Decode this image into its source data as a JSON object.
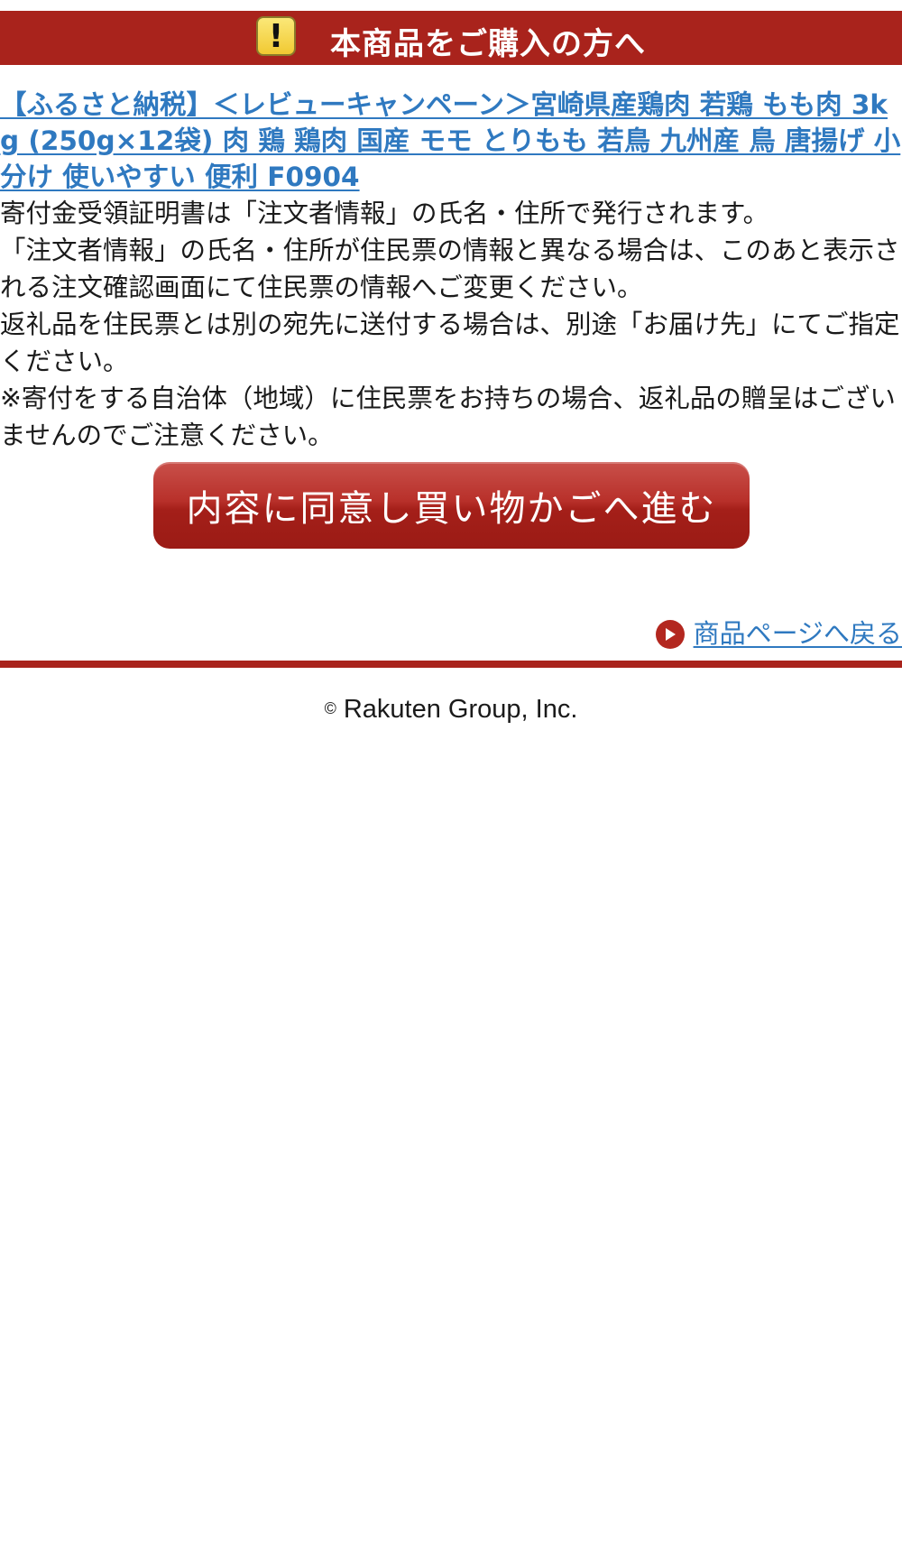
{
  "header": {
    "icon": "exclamation-warning-icon",
    "title": "本商品をご購入の方へ",
    "background_color": "#a9231c"
  },
  "product": {
    "link_text": "【ふるさと納税】＜レビューキャンペーン＞宮崎県産鶏肉 若鶏 もも肉 3kg (250g×12袋) 肉 鶏 鶏肉 国産 モモ とりもも 若鳥 九州産 鳥 唐揚げ 小分け 使いやすい 便利 F0904",
    "link_color": "#2f79c0"
  },
  "notice": {
    "lines": [
      "寄付金受領証明書は「注文者情報」の氏名・住所で発行されます。",
      "「注文者情報」の氏名・住所が住民票の情報と異なる場合は、このあと表示される注文確認画面にて住民票の情報へご変更ください。",
      "返礼品を住民票とは別の宛先に送付する場合は、別途「お届け先」にてご指定ください。",
      "※寄付をする自治体（地域）に住民票をお持ちの場合、返礼品の贈呈はございませんのでご注意ください。"
    ]
  },
  "cta": {
    "label": "内容に同意し買い物かごへ進む",
    "color": "#b3271f"
  },
  "back": {
    "icon": "play-arrow-icon",
    "label": "商品ページへ戻る"
  },
  "footer": {
    "copyright_mark": "©",
    "copyright_text": "Rakuten Group, Inc."
  }
}
